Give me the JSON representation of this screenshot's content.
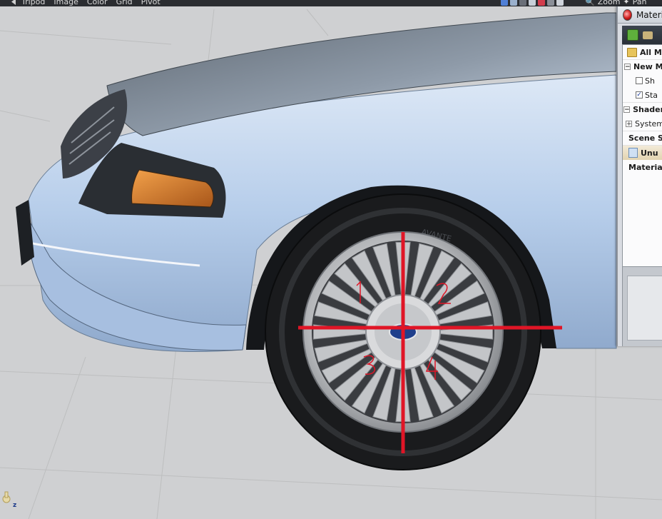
{
  "menu": {
    "items": [
      "Tripod",
      "Image",
      "Color",
      "Grid",
      "Pivot"
    ],
    "zoom_label": "Zoom",
    "pan_label": "Pan"
  },
  "viewport": {
    "background": "#cfd0d2",
    "car_body_color": "#b8d0ec",
    "marker_color": "#e01526",
    "marker_numbers": [
      "1",
      "2",
      "3",
      "4"
    ],
    "gizmo_axis_label": "z"
  },
  "panel": {
    "title": "Materi",
    "toolbar_icons": [
      "add-material-icon",
      "open-folder-icon"
    ],
    "rows": [
      {
        "label": "All M",
        "type": "folder"
      },
      {
        "label": "New M",
        "type": "group",
        "expanded": true
      },
      {
        "label": "Sh",
        "type": "checkbox",
        "checked": false
      },
      {
        "label": "Sta",
        "type": "checkbox",
        "checked": true
      },
      {
        "label": "Shader",
        "type": "group",
        "expanded": true
      },
      {
        "label": "System",
        "type": "subitem"
      },
      {
        "label": "Scene S",
        "type": "header"
      },
      {
        "label": "Unu",
        "type": "selected"
      },
      {
        "label": "Materia",
        "type": "header"
      }
    ]
  }
}
